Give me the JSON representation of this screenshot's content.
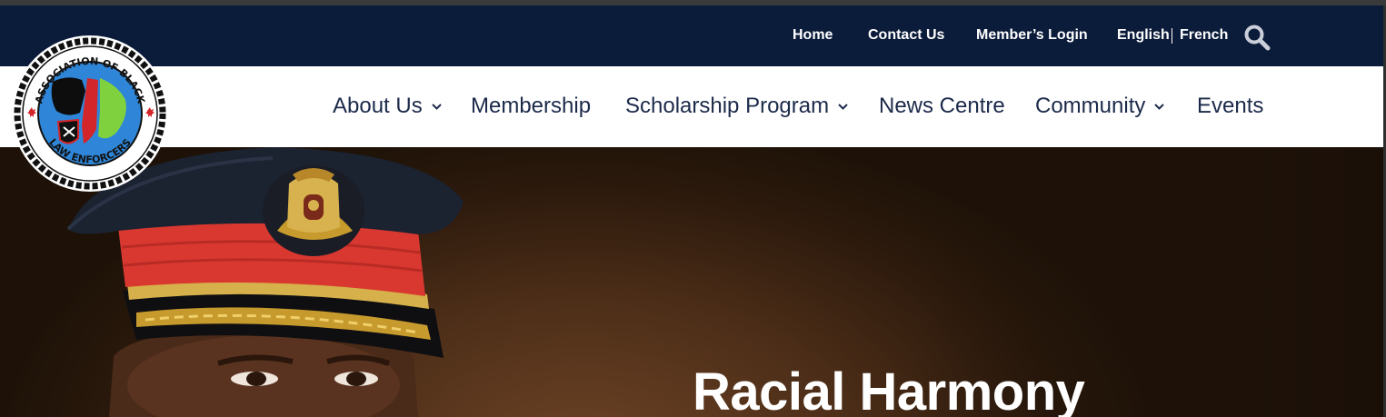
{
  "topbar": {
    "links": [
      "Home",
      "Contact Us",
      "Member’s Login"
    ],
    "languages": [
      "English",
      "French"
    ]
  },
  "logo": {
    "text_top": "ASSOCIATION OF BLACK",
    "text_bottom": "LAW ENFORCERS"
  },
  "nav": {
    "items": [
      {
        "label": "About Us",
        "has_dropdown": true
      },
      {
        "label": "Membership",
        "has_dropdown": false
      },
      {
        "label": "Scholarship Program",
        "has_dropdown": true
      },
      {
        "label": "News Centre",
        "has_dropdown": false
      },
      {
        "label": "Community",
        "has_dropdown": true
      },
      {
        "label": "Events",
        "has_dropdown": false
      }
    ]
  },
  "hero": {
    "title": "Racial Harmony"
  },
  "colors": {
    "topbar_bg": "#0b1b3a",
    "nav_text": "#1c2a4a",
    "hero_bg": "#4d2e18"
  }
}
